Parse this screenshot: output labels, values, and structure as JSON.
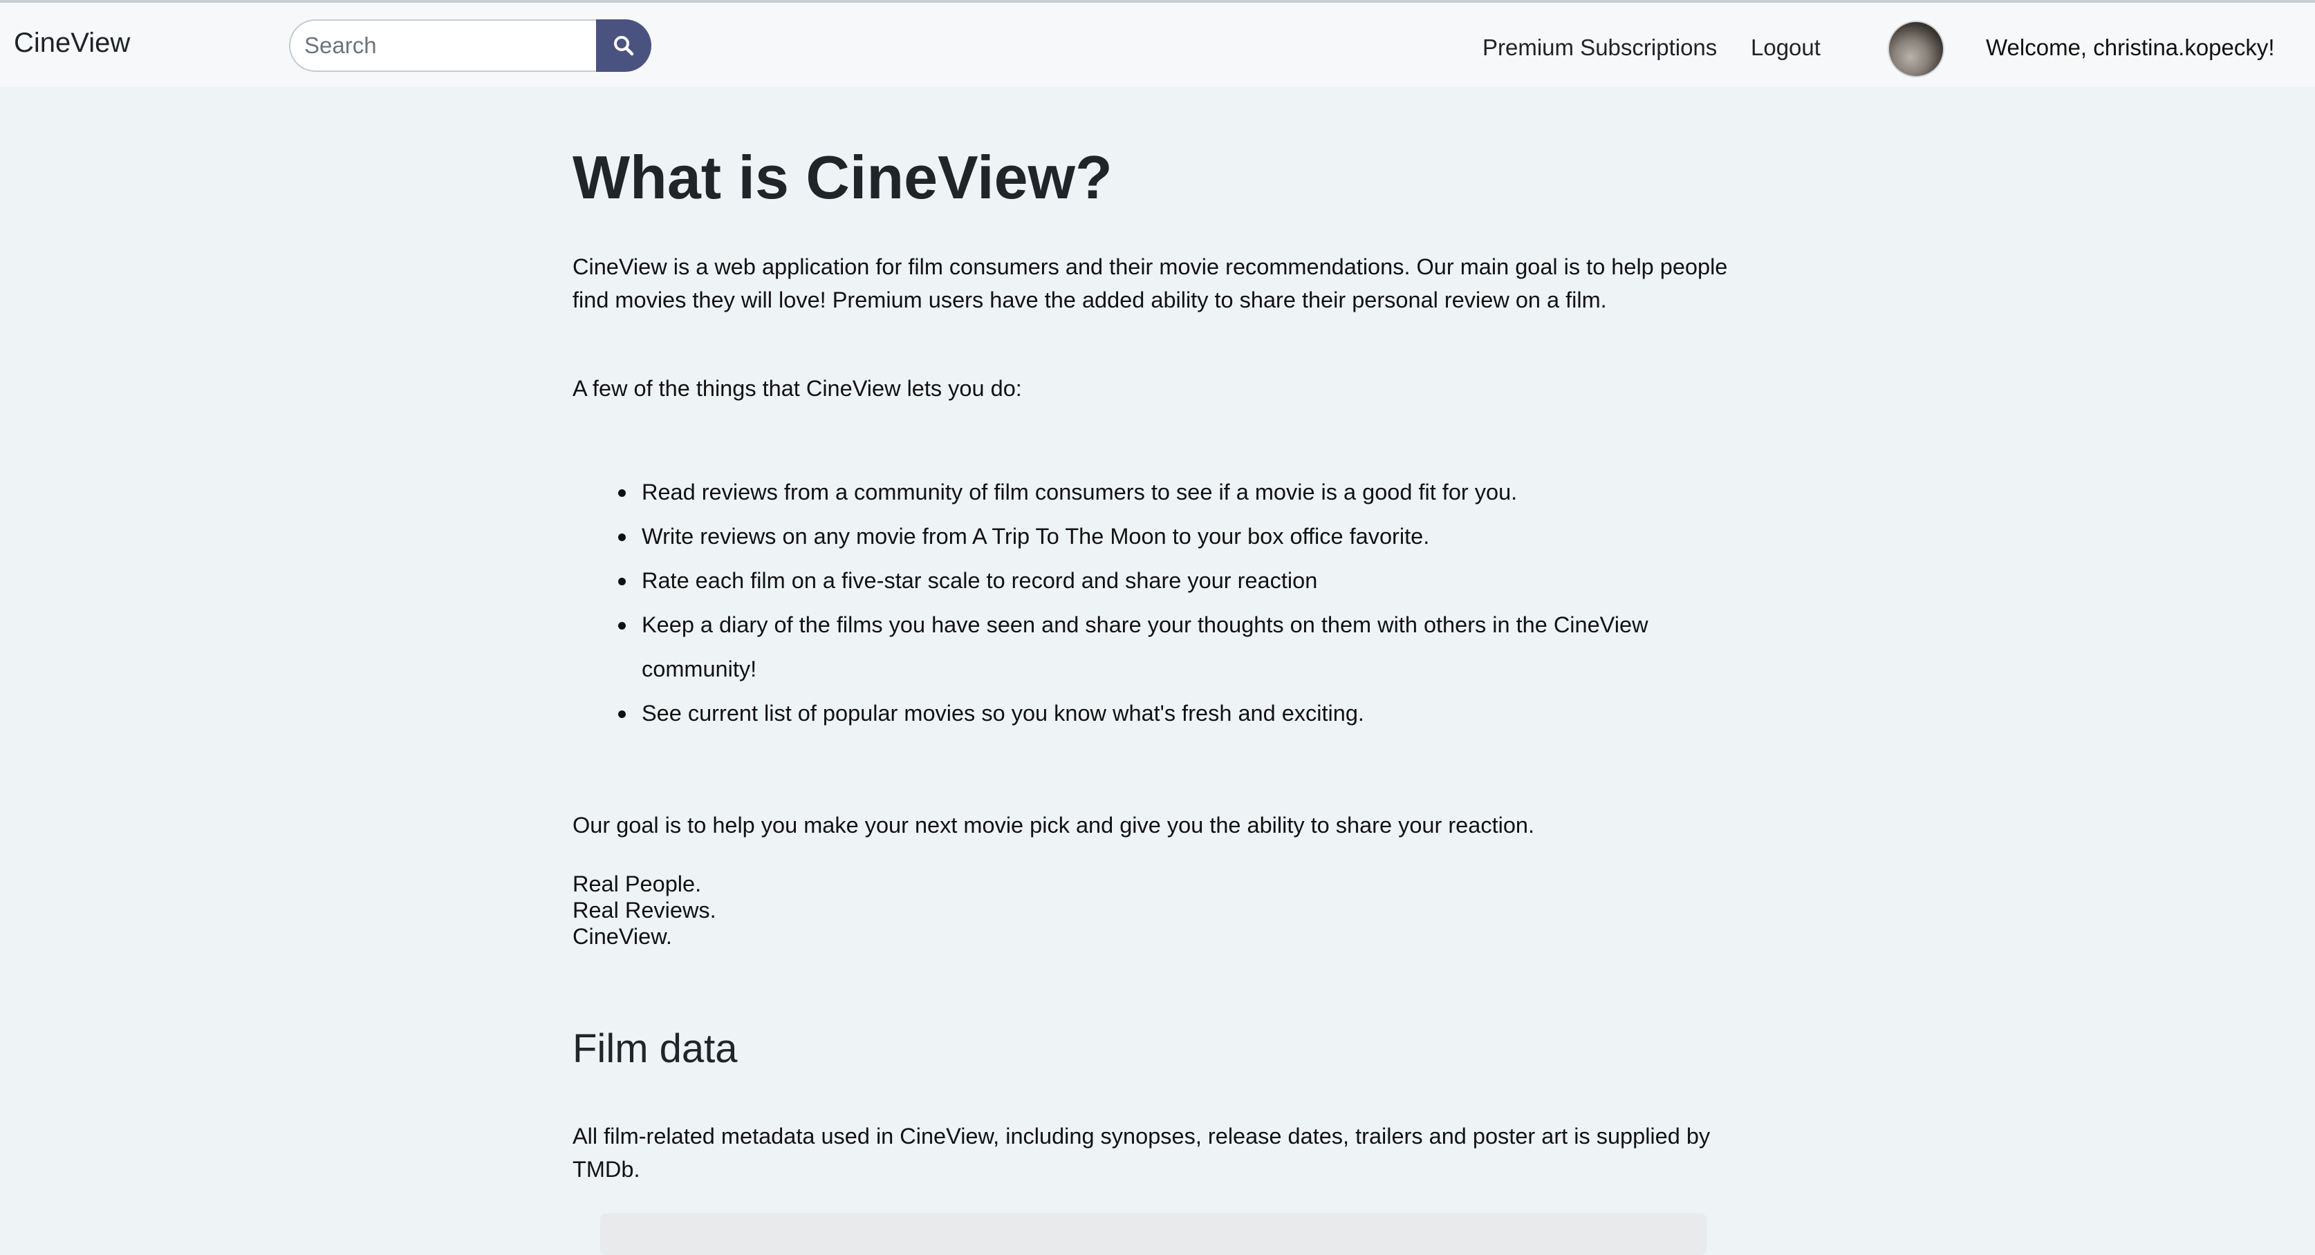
{
  "nav": {
    "brand": "CineView",
    "search_placeholder": "Search",
    "premium_link": "Premium Subscriptions",
    "logout_link": "Logout",
    "welcome": "Welcome, christina.kopecky!"
  },
  "main": {
    "title": "What is CineView?",
    "intro_line1": "CineView is a web application for film consumers and their movie recommendations. Our main goal is to help people",
    "intro_line2": "find movies they will love! Premium users have the added ability to share their personal review on a film.",
    "things_intro": "A few of the things that CineView lets you do:",
    "features": [
      "Read reviews from a community of film consumers to see if a movie is a good fit for you.",
      "Write reviews on any movie from A Trip To The Moon to your box office favorite.",
      "Rate each film on a five-star scale to record and share your reaction",
      "Keep a diary of the films you have seen and share your thoughts on them with others in the CineView",
      "community!",
      "See current list of popular movies so you know what's fresh and exciting."
    ],
    "goal": "Our goal is to help you make your next movie pick and give you the ability to share your reaction.",
    "tagline": [
      "Real People.",
      "Real Reviews.",
      "CineView."
    ],
    "film_data_title": "Film data",
    "film_data_line1": "All film-related metadata used in CineView, including synopses, release dates, trailers and poster art is supplied by",
    "film_data_line2": "TMDb."
  },
  "icons": {
    "search": "magnifier-icon"
  },
  "colors": {
    "search_button": "#4a5380",
    "page_background": "#eef3f6",
    "navbar_background": "#f7f8fa"
  }
}
